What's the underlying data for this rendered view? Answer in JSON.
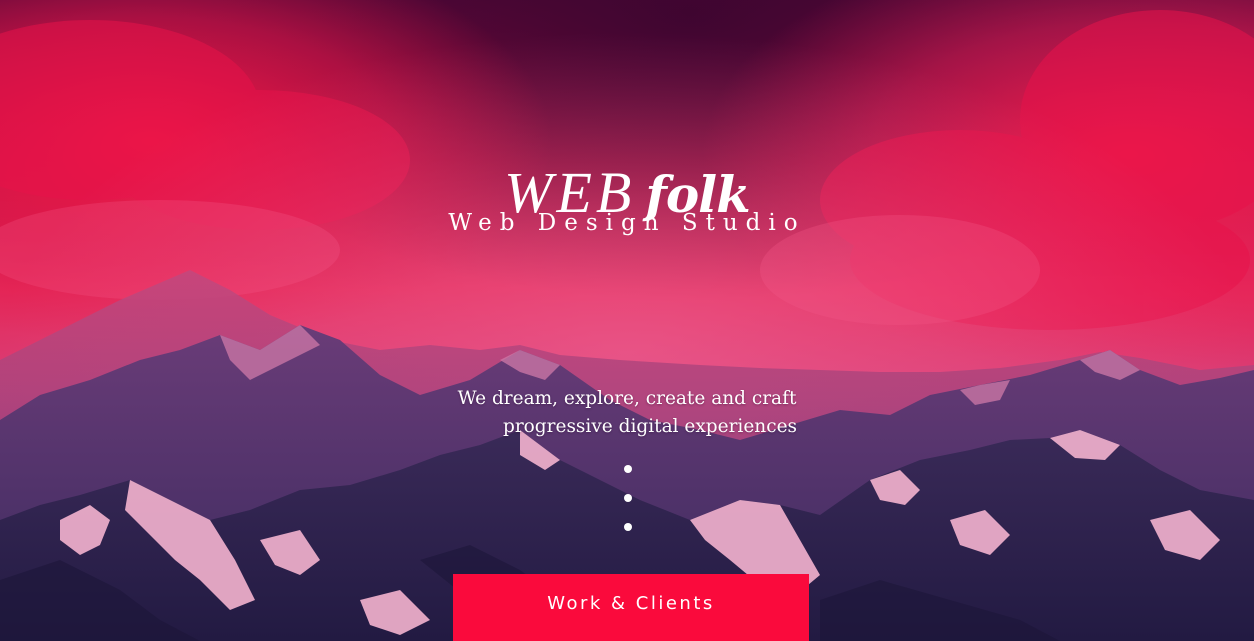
{
  "brand": {
    "word": "WEB",
    "script": "folk",
    "tagline": "Web Design Studio"
  },
  "hero": {
    "description_line1": "We dream, explore, create and craft",
    "description_line2": "progressive digital experiences",
    "dots": [
      "dot-1",
      "dot-2",
      "dot-3"
    ],
    "background_icon": "mountain-sunset-photo"
  },
  "cta": {
    "label": "Work & Clients"
  },
  "colors": {
    "accent": "#fa0a3c",
    "sky_top": "#4a0a3a",
    "cloud": "#e8104a",
    "mountain_dark": "#2a1d4a",
    "snow": "#f0a4c4"
  }
}
